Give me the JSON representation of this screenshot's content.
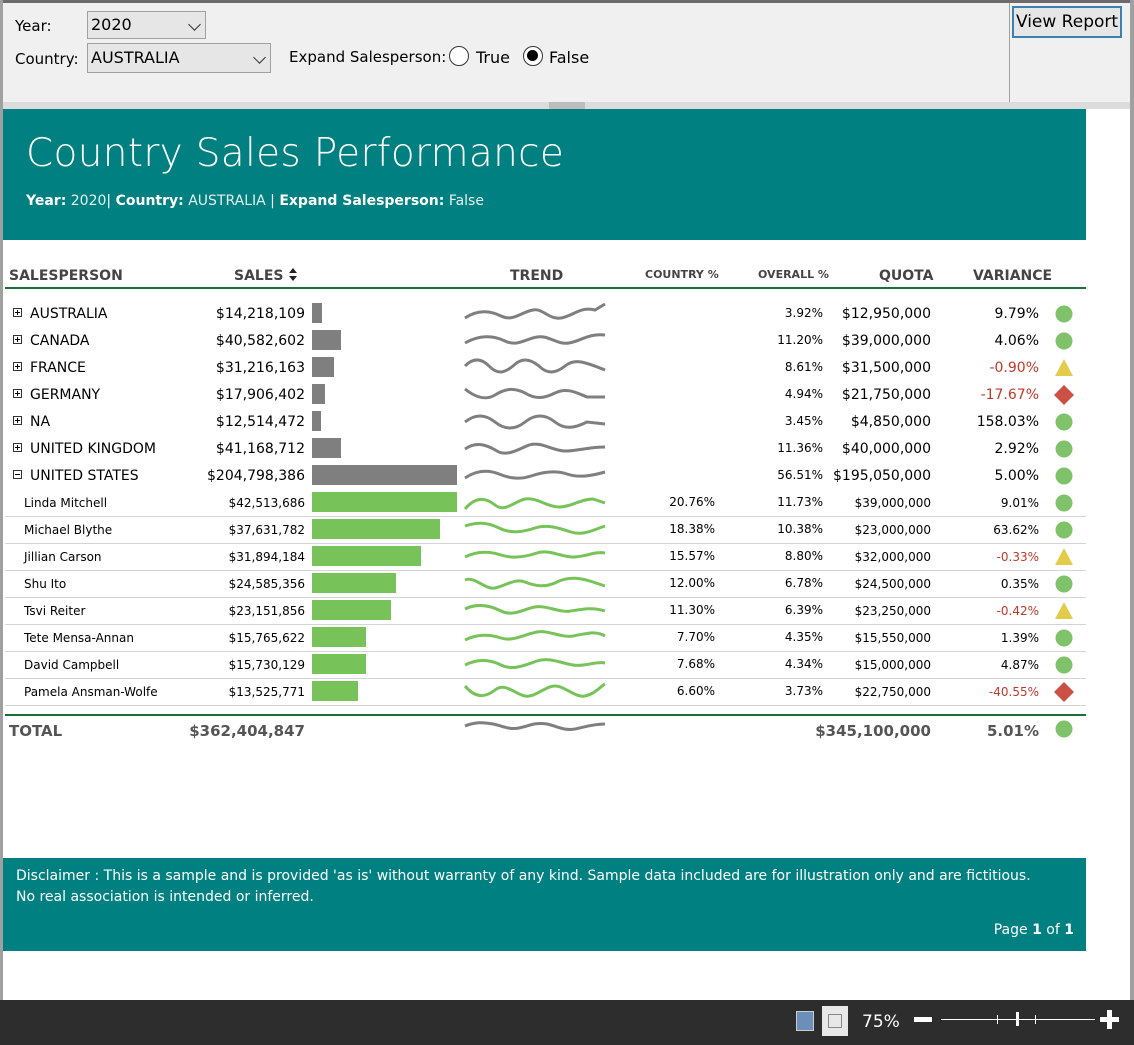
{
  "params": {
    "year_label": "Year:",
    "year_value": "2020",
    "country_label": "Country:",
    "country_value": "AUSTRALIA",
    "expand_label": "Expand Salesperson:",
    "expand_true": "True",
    "expand_false": "False",
    "expand_selected": "False",
    "view_report": "View Report"
  },
  "report": {
    "title": "Country Sales Performance",
    "sub_year_label": "Year:",
    "sub_year_value": "2020",
    "sub_country_label": "Country:",
    "sub_country_value": "AUSTRALIA",
    "sub_expand_label": "Expand Salesperson:",
    "sub_expand_value": "False",
    "sep": "|"
  },
  "columns": {
    "salesperson": "SALESPERSON",
    "sales": "SALES",
    "trend": "TREND",
    "country_pct": "COUNTRY %",
    "overall_pct": "OVERALL %",
    "quota": "QUOTA",
    "variance": "VARIANCE"
  },
  "colors": {
    "teal": "#008080",
    "bar_gray": "#7f7f7f",
    "bar_green": "#77c35a",
    "trend_gray": "#7f7f7f",
    "trend_green": "#77c35a",
    "negative": "#c0392b",
    "ind_green": "#7fc26a",
    "ind_yellow": "#e3cc4a",
    "ind_red": "#cc5044"
  },
  "countries": [
    {
      "name": "AUSTRALIA",
      "sales": "$14,218,109",
      "sales_val": 14218109,
      "overall": "3.92%",
      "quota": "$12,950,000",
      "variance": "9.79%",
      "negative": false,
      "indicator": "green",
      "expanded": false
    },
    {
      "name": "CANADA",
      "sales": "$40,582,602",
      "sales_val": 40582602,
      "overall": "11.20%",
      "quota": "$39,000,000",
      "variance": "4.06%",
      "negative": false,
      "indicator": "green",
      "expanded": false
    },
    {
      "name": "FRANCE",
      "sales": "$31,216,163",
      "sales_val": 31216163,
      "overall": "8.61%",
      "quota": "$31,500,000",
      "variance": "-0.90%",
      "negative": true,
      "indicator": "yellow",
      "expanded": false
    },
    {
      "name": "GERMANY",
      "sales": "$17,906,402",
      "sales_val": 17906402,
      "overall": "4.94%",
      "quota": "$21,750,000",
      "variance": "-17.67%",
      "negative": true,
      "indicator": "red",
      "expanded": false
    },
    {
      "name": "NA",
      "sales": "$12,514,472",
      "sales_val": 12514472,
      "overall": "3.45%",
      "quota": "$4,850,000",
      "variance": "158.03%",
      "negative": false,
      "indicator": "green",
      "expanded": false
    },
    {
      "name": "UNITED KINGDOM",
      "sales": "$41,168,712",
      "sales_val": 41168712,
      "overall": "11.36%",
      "quota": "$40,000,000",
      "variance": "2.92%",
      "negative": false,
      "indicator": "green",
      "expanded": false
    },
    {
      "name": "UNITED STATES",
      "sales": "$204,798,386",
      "sales_val": 204798386,
      "overall": "56.51%",
      "quota": "$195,050,000",
      "variance": "5.00%",
      "negative": false,
      "indicator": "green",
      "expanded": true
    }
  ],
  "salespeople": [
    {
      "name": "Linda Mitchell",
      "sales": "$42,513,686",
      "sales_val": 42513686,
      "country_pct": "20.76%",
      "overall": "11.73%",
      "quota": "$39,000,000",
      "variance": "9.01%",
      "negative": false,
      "indicator": "green"
    },
    {
      "name": "Michael Blythe",
      "sales": "$37,631,782",
      "sales_val": 37631782,
      "country_pct": "18.38%",
      "overall": "10.38%",
      "quota": "$23,000,000",
      "variance": "63.62%",
      "negative": false,
      "indicator": "green"
    },
    {
      "name": "Jillian Carson",
      "sales": "$31,894,184",
      "sales_val": 31894184,
      "country_pct": "15.57%",
      "overall": "8.80%",
      "quota": "$32,000,000",
      "variance": "-0.33%",
      "negative": true,
      "indicator": "yellow"
    },
    {
      "name": "Shu Ito",
      "sales": "$24,585,356",
      "sales_val": 24585356,
      "country_pct": "12.00%",
      "overall": "6.78%",
      "quota": "$24,500,000",
      "variance": "0.35%",
      "negative": false,
      "indicator": "green"
    },
    {
      "name": "Tsvi Reiter",
      "sales": "$23,151,856",
      "sales_val": 23151856,
      "country_pct": "11.30%",
      "overall": "6.39%",
      "quota": "$23,250,000",
      "variance": "-0.42%",
      "negative": true,
      "indicator": "yellow"
    },
    {
      "name": "Tete Mensa-Annan",
      "sales": "$15,765,622",
      "sales_val": 15765622,
      "country_pct": "7.70%",
      "overall": "4.35%",
      "quota": "$15,550,000",
      "variance": "1.39%",
      "negative": false,
      "indicator": "green"
    },
    {
      "name": "David Campbell",
      "sales": "$15,730,129",
      "sales_val": 15730129,
      "country_pct": "7.68%",
      "overall": "4.34%",
      "quota": "$15,000,000",
      "variance": "4.87%",
      "negative": false,
      "indicator": "green"
    },
    {
      "name": "Pamela Ansman-Wolfe",
      "sales": "$13,525,771",
      "sales_val": 13525771,
      "country_pct": "6.60%",
      "overall": "3.73%",
      "quota": "$22,750,000",
      "variance": "-40.55%",
      "negative": true,
      "indicator": "red"
    }
  ],
  "total": {
    "label": "TOTAL",
    "sales": "$362,404,847",
    "quota": "$345,100,000",
    "variance": "5.01%",
    "indicator": "green"
  },
  "footer": {
    "disclaimer": "Disclaimer : This is a sample and is provided 'as is' without warranty of any kind.  Sample data included are for illustration only and are fictitious.  No real association is intended or inferred.",
    "page_label": "Page",
    "page_current": "1",
    "page_of": "of",
    "page_total": "1"
  },
  "statusbar": {
    "zoom": "75%"
  }
}
